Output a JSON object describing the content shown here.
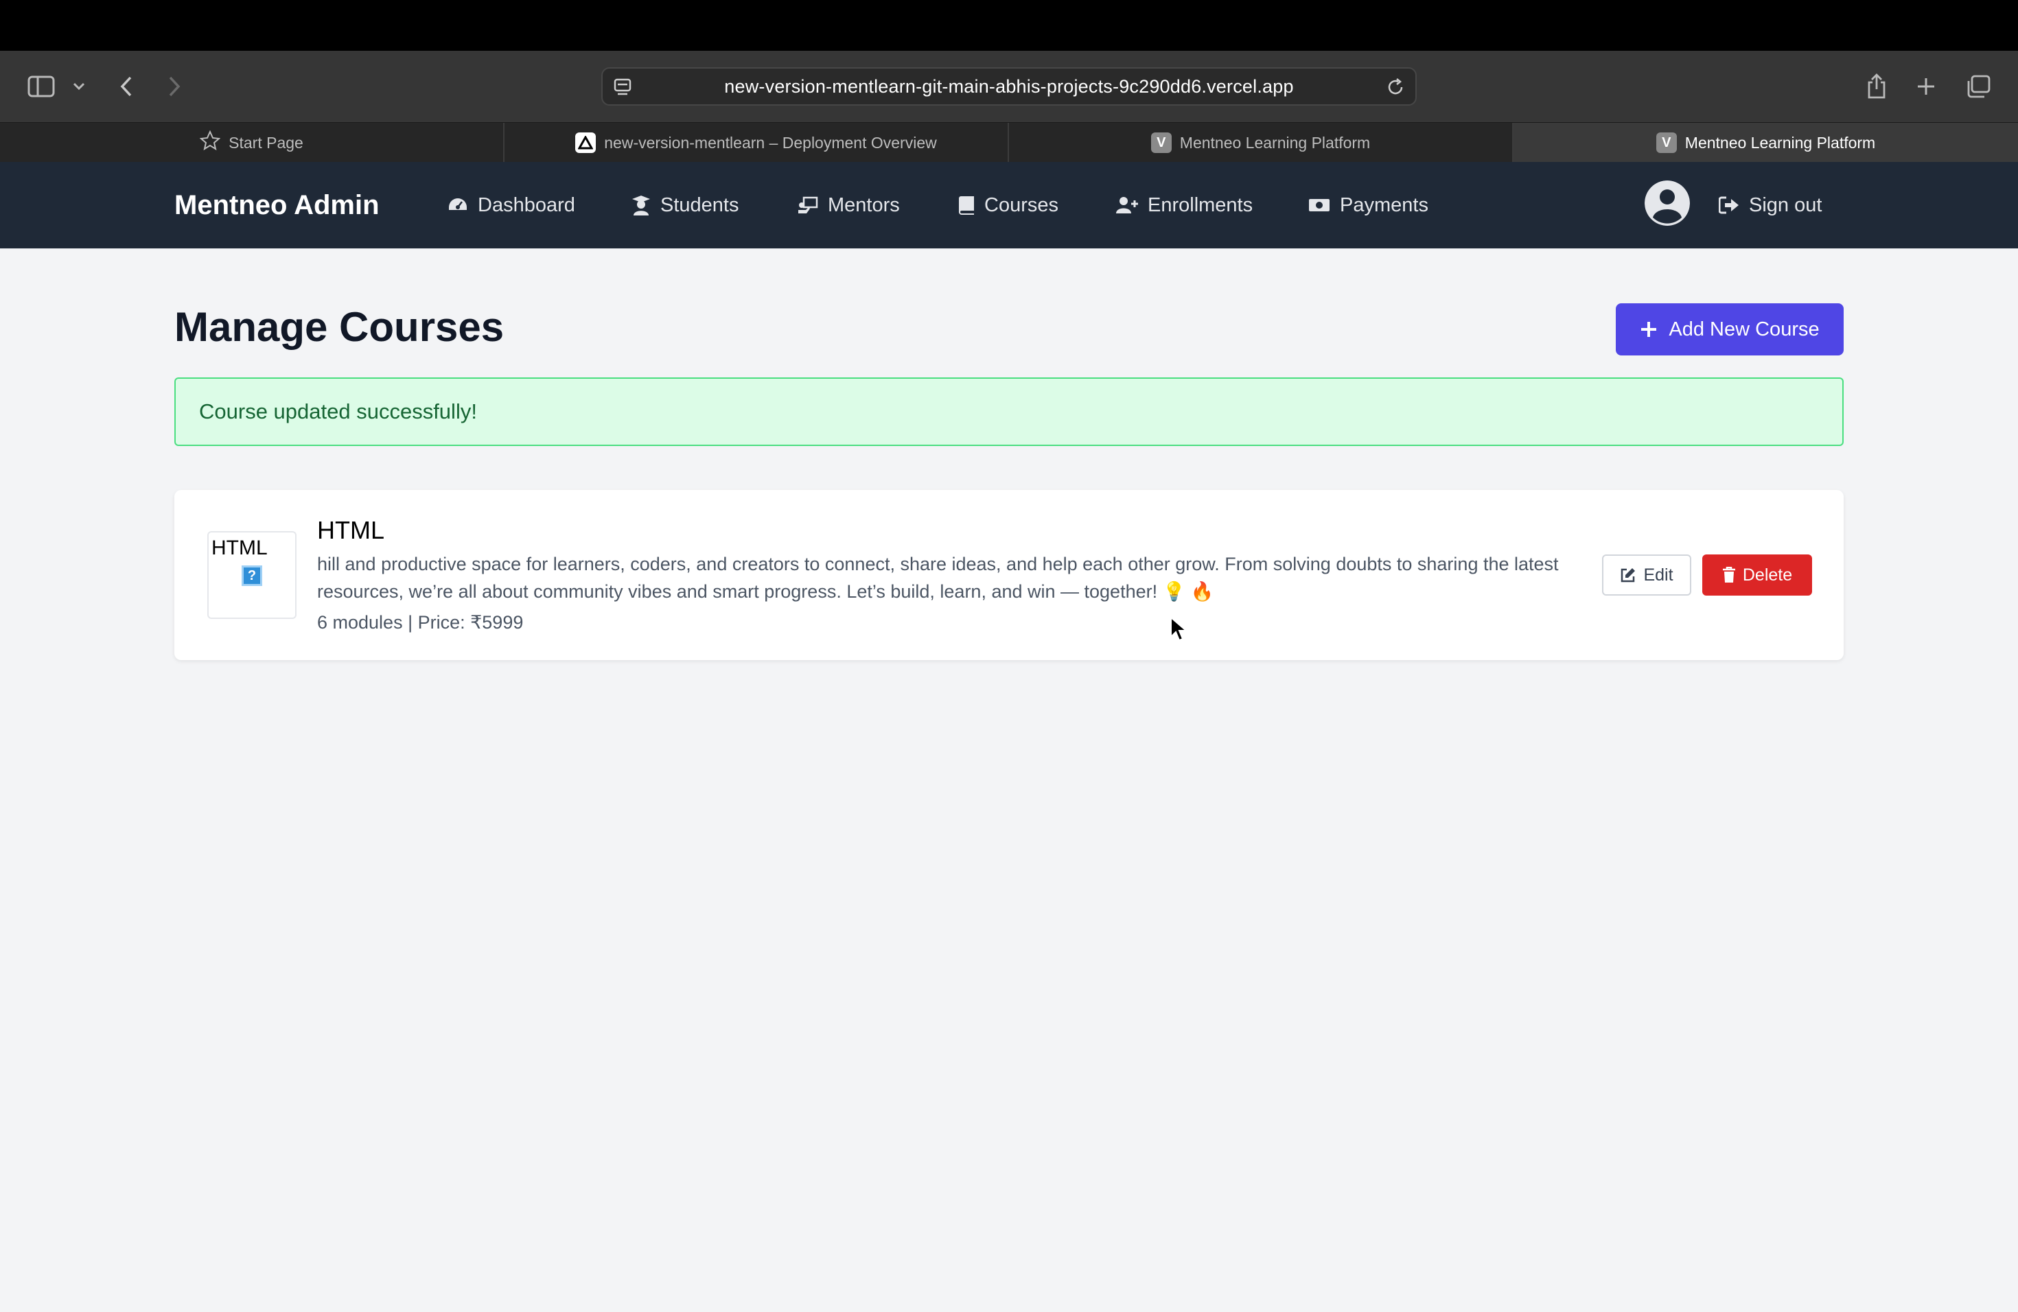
{
  "browser": {
    "url": "new-version-mentlearn-git-main-abhis-projects-9c290dd6.vercel.app",
    "tabs": [
      {
        "label": "Start Page",
        "icon": "star-icon"
      },
      {
        "label": "new-version-mentlearn – Deployment Overview",
        "icon": "vercel-icon"
      },
      {
        "label": "Mentneo Learning Platform",
        "icon": "v-favicon",
        "favicon_letter": "V"
      },
      {
        "label": "Mentneo Learning Platform",
        "icon": "v-favicon",
        "favicon_letter": "V",
        "active": true
      }
    ]
  },
  "nav": {
    "brand": "Mentneo Admin",
    "items": [
      {
        "label": "Dashboard",
        "icon": "gauge-icon"
      },
      {
        "label": "Students",
        "icon": "graduate-icon"
      },
      {
        "label": "Mentors",
        "icon": "chalkboard-teacher-icon"
      },
      {
        "label": "Courses",
        "icon": "book-icon"
      },
      {
        "label": "Enrollments",
        "icon": "user-plus-icon"
      },
      {
        "label": "Payments",
        "icon": "money-bill-icon"
      }
    ],
    "sign_out": "Sign out"
  },
  "main": {
    "title": "Manage Courses",
    "add_button": "Add New Course",
    "alert": "Course updated successfully!",
    "courses": [
      {
        "thumbnail_alt": "HTML",
        "title": "HTML",
        "description": "hill and productive space for learners, coders, and creators to connect, share ideas, and help each other grow. From solving doubts to sharing the latest resources, we’re all about community vibes and smart progress. Let’s build, learn, and win — together! 💡 🔥",
        "meta": "6 modules | Price: ₹5999",
        "edit_label": "Edit",
        "delete_label": "Delete"
      }
    ]
  },
  "colors": {
    "nav_bg": "#1f2937",
    "primary": "#4f46e5",
    "danger": "#dc2626",
    "success_bg": "#dcfce7",
    "success_text": "#166534"
  }
}
